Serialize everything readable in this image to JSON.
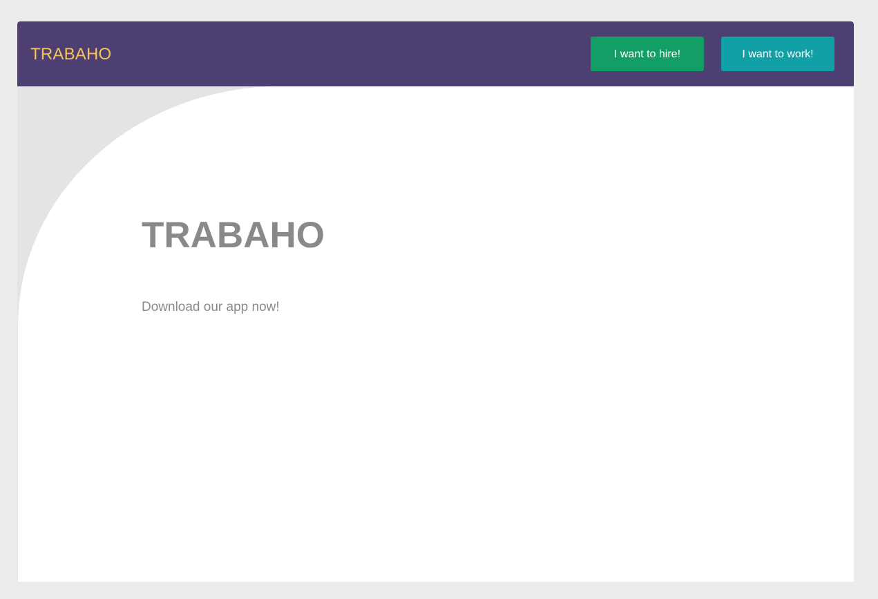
{
  "navbar": {
    "brand": "TRABAHO",
    "hire_button": "I want to hire!",
    "work_button": "I want to work!"
  },
  "hero": {
    "title": "TRABAHO",
    "subtitle": "Download our app now!"
  },
  "colors": {
    "navbar_bg": "#4d3f72",
    "brand_text": "#f6c35a",
    "hire_button_bg": "#139e66",
    "work_button_bg": "#10a0a6",
    "hero_text": "#898989",
    "page_bg": "#ececec",
    "hero_shape_bg": "#e4e4e6"
  }
}
